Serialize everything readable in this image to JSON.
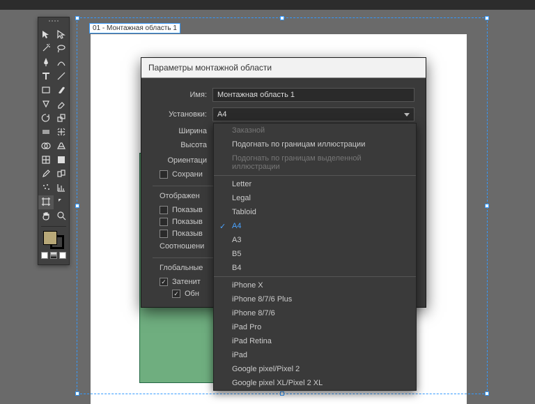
{
  "artboard_tab": "01 - Монтажная область 1",
  "dialog": {
    "title": "Параметры монтажной области",
    "name_label": "Имя:",
    "name_value": "Монтажная область 1",
    "preset_label": "Установки:",
    "preset_value": "A4",
    "width_label": "Ширина",
    "height_label": "Высота",
    "orient_label": "Ориентаци",
    "keep_label": "Сохрани",
    "display_section": "Отображен",
    "show1": "Показыв",
    "show2": "Показыв",
    "show3": "Показыв",
    "aspect_label": "Соотношени",
    "global_section": "Глобальные",
    "dim_label": "Затенит",
    "dim_checked": true,
    "upd_label": "Обн",
    "upd_checked": true
  },
  "preset_options": [
    {
      "label": "Заказной",
      "disabled": true
    },
    {
      "label": "Подогнать по границам иллюстрации",
      "disabled": false
    },
    {
      "label": "Подогнать по границам выделенной иллюстрации",
      "disabled": true
    },
    {
      "divider": true
    },
    {
      "label": "Letter"
    },
    {
      "label": "Legal"
    },
    {
      "label": "Tabloid"
    },
    {
      "label": "A4",
      "selected": true
    },
    {
      "label": "A3"
    },
    {
      "label": "B5"
    },
    {
      "label": "B4"
    },
    {
      "divider": true
    },
    {
      "label": "iPhone X"
    },
    {
      "label": "iPhone 8/7/6 Plus"
    },
    {
      "label": "iPhone 8/7/6"
    },
    {
      "label": "iPad Pro"
    },
    {
      "label": "iPad Retina"
    },
    {
      "label": "iPad"
    },
    {
      "label": "Google pixel/Pixel 2"
    },
    {
      "label": "Google pixel XL/Pixel 2 XL"
    }
  ],
  "tools": [
    [
      "selection",
      "direct-selection"
    ],
    [
      "magic-wand",
      "lasso"
    ],
    [
      "pen",
      "curvature"
    ],
    [
      "type",
      "line"
    ],
    [
      "rectangle",
      "brush"
    ],
    [
      "shaper",
      "eraser"
    ],
    [
      "rotate",
      "scale"
    ],
    [
      "width",
      "free-transform"
    ],
    [
      "shape-builder",
      "perspective"
    ],
    [
      "mesh",
      "gradient"
    ],
    [
      "eyedropper",
      "blend"
    ],
    [
      "symbol-spray",
      "graph"
    ],
    [
      "artboard",
      "slice"
    ],
    [
      "hand",
      "zoom"
    ]
  ],
  "colors": {
    "fill": "#b8a878",
    "stroke": "#000000"
  }
}
